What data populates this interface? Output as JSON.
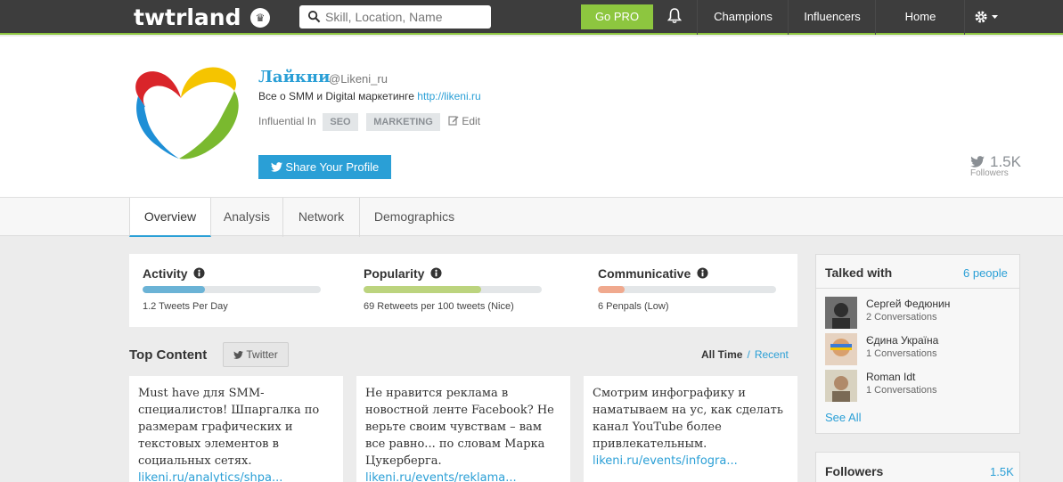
{
  "topbar": {
    "logo_text": "twtrland",
    "search_placeholder": "Skill, Location, Name",
    "gopro_label": "Go PRO",
    "nav": [
      "Champions",
      "Influencers",
      "Home"
    ]
  },
  "profile": {
    "name": "Лайкни",
    "handle": "@Likeni_ru",
    "bio_text": "Все о SMM и Digital маркетинге",
    "bio_link": "http://likeni.ru",
    "influential_label": "Influential In",
    "tags": [
      "SEO",
      "MARKETING"
    ],
    "edit_label": "Edit",
    "share_label": "Share Your Profile",
    "followers_count": "1.5K",
    "followers_label": "Followers"
  },
  "tabs": [
    {
      "label": "Overview",
      "active": true
    },
    {
      "label": "Analysis",
      "active": false
    },
    {
      "label": "Network",
      "active": false
    },
    {
      "label": "Demographics",
      "active": false
    }
  ],
  "stats": [
    {
      "title": "Activity",
      "sub": "1.2 Tweets Per Day",
      "level": 0.35,
      "color": "#6bb3d6"
    },
    {
      "title": "Popularity",
      "sub": "69 Retweets per 100 tweets (Nice)",
      "level": 0.66,
      "color": "#bcd47e"
    },
    {
      "title": "Communicative",
      "sub": "6 Penpals (Low)",
      "level": 0.15,
      "color": "#f0a98e"
    }
  ],
  "top_content": {
    "title": "Top Content",
    "filter_label": "Twitter",
    "time_all": "All Time",
    "time_sep": "/",
    "time_recent": "Recent",
    "cards": [
      {
        "text": "Must have для SMM-специалистов! Шпаргалка по размерам графических и текстовых элементов в социальных сетях.",
        "link": "likeni.ru/analytics/shpa..."
      },
      {
        "text": "Не нравится реклама в новостной ленте Facebook? Не верьте своим чувствам – вам все равно... по словам Марка Цукерберга.",
        "link": "likeni.ru/events/reklama..."
      },
      {
        "text": "Смотрим инфографику и наматываем на ус, как сделать канал YouTube более привлекательным.",
        "link": "likeni.ru/events/infogra..."
      }
    ]
  },
  "talked_with": {
    "title": "Talked with",
    "count": "6 people",
    "people": [
      {
        "name": "Сергей Федюнин",
        "convos": "2 Conversations",
        "color": "#3a3a3a"
      },
      {
        "name": "Єдина Україна",
        "convos": "1 Conversations",
        "color": "#d9a06e"
      },
      {
        "name": "Roman Idt",
        "convos": "1 Conversations",
        "color": "#c8b89a"
      }
    ],
    "see_all": "See All"
  },
  "followers_box": {
    "title": "Followers",
    "count": "1.5K"
  }
}
